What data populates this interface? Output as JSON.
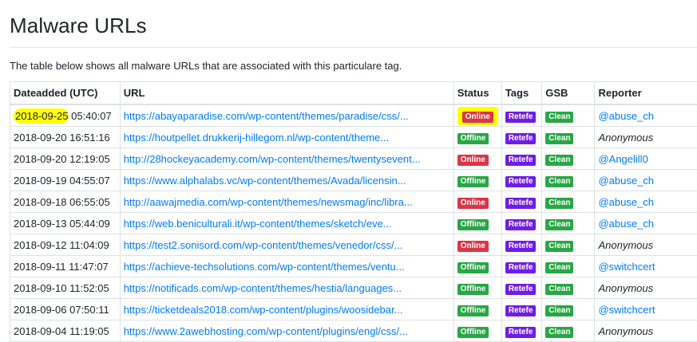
{
  "page": {
    "title": "Malware URLs",
    "intro": "The table below shows all malware URLs that are associated with this particulare tag."
  },
  "table": {
    "headers": {
      "date": "Dateadded (UTC)",
      "url": "URL",
      "status": "Status",
      "tags": "Tags",
      "gsb": "GSB",
      "reporter": "Reporter"
    },
    "rows": [
      {
        "date_hl": "2018-09-25",
        "date_rest": " 05:40:07",
        "url": "https://abayaparadise.com/wp-content/themes/paradise/css/...",
        "status": "Online",
        "tag": "Retefe",
        "gsb": "Clean",
        "reporter": "@abuse_ch"
      },
      {
        "date": "2018-09-20 16:51:16",
        "url": "https://houtpellet.drukkerij-hillegom.nl/wp-content/theme...",
        "status": "Offline",
        "tag": "Retefe",
        "gsb": "Clean",
        "reporter": "Anonymous"
      },
      {
        "date": "2018-09-20 12:19:05",
        "url": "http://28hockeyacademy.com/wp-content/themes/twentysevent...",
        "status": "Online",
        "tag": "Retefe",
        "gsb": "Clean",
        "reporter": "@Angelill0"
      },
      {
        "date": "2018-09-19 04:55:07",
        "url": "https://www.alphalabs.vc/wp-content/themes/Avada/licensin...",
        "status": "Offline",
        "tag": "Retefe",
        "gsb": "Clean",
        "reporter": "@abuse_ch"
      },
      {
        "date": "2018-09-18 06:55:05",
        "url": "http://aawajmedia.com/wp-content/themes/newsmag/inc/libra...",
        "status": "Online",
        "tag": "Retefe",
        "gsb": "Clean",
        "reporter": "@abuse_ch"
      },
      {
        "date": "2018-09-13 05:44:09",
        "url": "https://web.beniculturali.it/wp-content/themes/sketch/eve...",
        "status": "Offline",
        "tag": "Retefe",
        "gsb": "Clean",
        "reporter": "@abuse_ch"
      },
      {
        "date": "2018-09-12 11:04:09",
        "url": "https://test2.sonisord.com/wp-content/themes/venedor/css/...",
        "status": "Online",
        "tag": "Retefe",
        "gsb": "Clean",
        "reporter": "Anonymous"
      },
      {
        "date": "2018-09-11 11:47:07",
        "url": "https://achieve-techsolutions.com/wp-content/themes/ventu...",
        "status": "Offline",
        "tag": "Retefe",
        "gsb": "Clean",
        "reporter": "@switchcert"
      },
      {
        "date": "2018-09-10 11:52:05",
        "url": "https://notificads.com/wp-content/themes/hestia/languages...",
        "status": "Offline",
        "tag": "Retefe",
        "gsb": "Clean",
        "reporter": "Anonymous"
      },
      {
        "date": "2018-09-06 07:50:11",
        "url": "https://ticketdeals2018.com/wp-content/plugins/woosidebar...",
        "status": "Offline",
        "tag": "Retefe",
        "gsb": "Clean",
        "reporter": "@switchcert"
      },
      {
        "date": "2018-09-04 11:19:05",
        "url": "https://www.2awebhosting.com/wp-content/plugins/engl/css/...",
        "status": "Offline",
        "tag": "Retefe",
        "gsb": "Clean",
        "reporter": "Anonymous"
      }
    ]
  }
}
